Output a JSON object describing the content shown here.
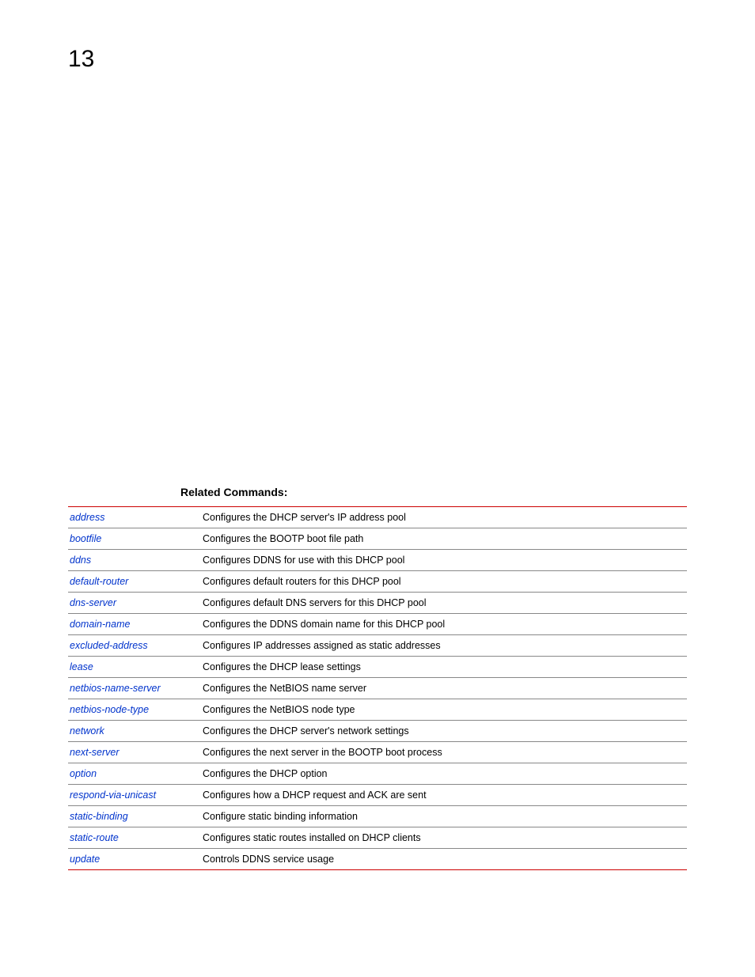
{
  "page_number": "13",
  "section_title": "Related Commands:",
  "rows": [
    {
      "cmd": "address",
      "desc": "Configures the DHCP server's IP address pool"
    },
    {
      "cmd": "bootfile",
      "desc": "Configures the BOOTP boot file path"
    },
    {
      "cmd": "ddns",
      "desc": "Configures DDNS for use with this DHCP pool"
    },
    {
      "cmd": "default-router",
      "desc": "Configures default routers for this DHCP pool"
    },
    {
      "cmd": "dns-server",
      "desc": "Configures default DNS servers for this DHCP pool"
    },
    {
      "cmd": "domain-name",
      "desc": "Configures the DDNS domain name for this DHCP pool"
    },
    {
      "cmd": "excluded-address",
      "desc": "Configures IP addresses assigned as static addresses"
    },
    {
      "cmd": "lease",
      "desc": "Configures the DHCP lease settings"
    },
    {
      "cmd": "netbios-name-server",
      "desc": "Configures the NetBIOS name server"
    },
    {
      "cmd": "netbios-node-type",
      "desc": "Configures the NetBIOS node type"
    },
    {
      "cmd": "network",
      "desc": "Configures the DHCP server's network settings"
    },
    {
      "cmd": "next-server",
      "desc": "Configures the next server in the BOOTP boot process"
    },
    {
      "cmd": "option",
      "desc": "Configures the DHCP option"
    },
    {
      "cmd": "respond-via-unicast",
      "desc": "Configures how a DHCP request and ACK are sent"
    },
    {
      "cmd": "static-binding",
      "desc": "Configure static binding information"
    },
    {
      "cmd": "static-route",
      "desc": "Configures static routes installed on DHCP clients"
    },
    {
      "cmd": "update",
      "desc": "Controls DDNS service usage"
    }
  ]
}
